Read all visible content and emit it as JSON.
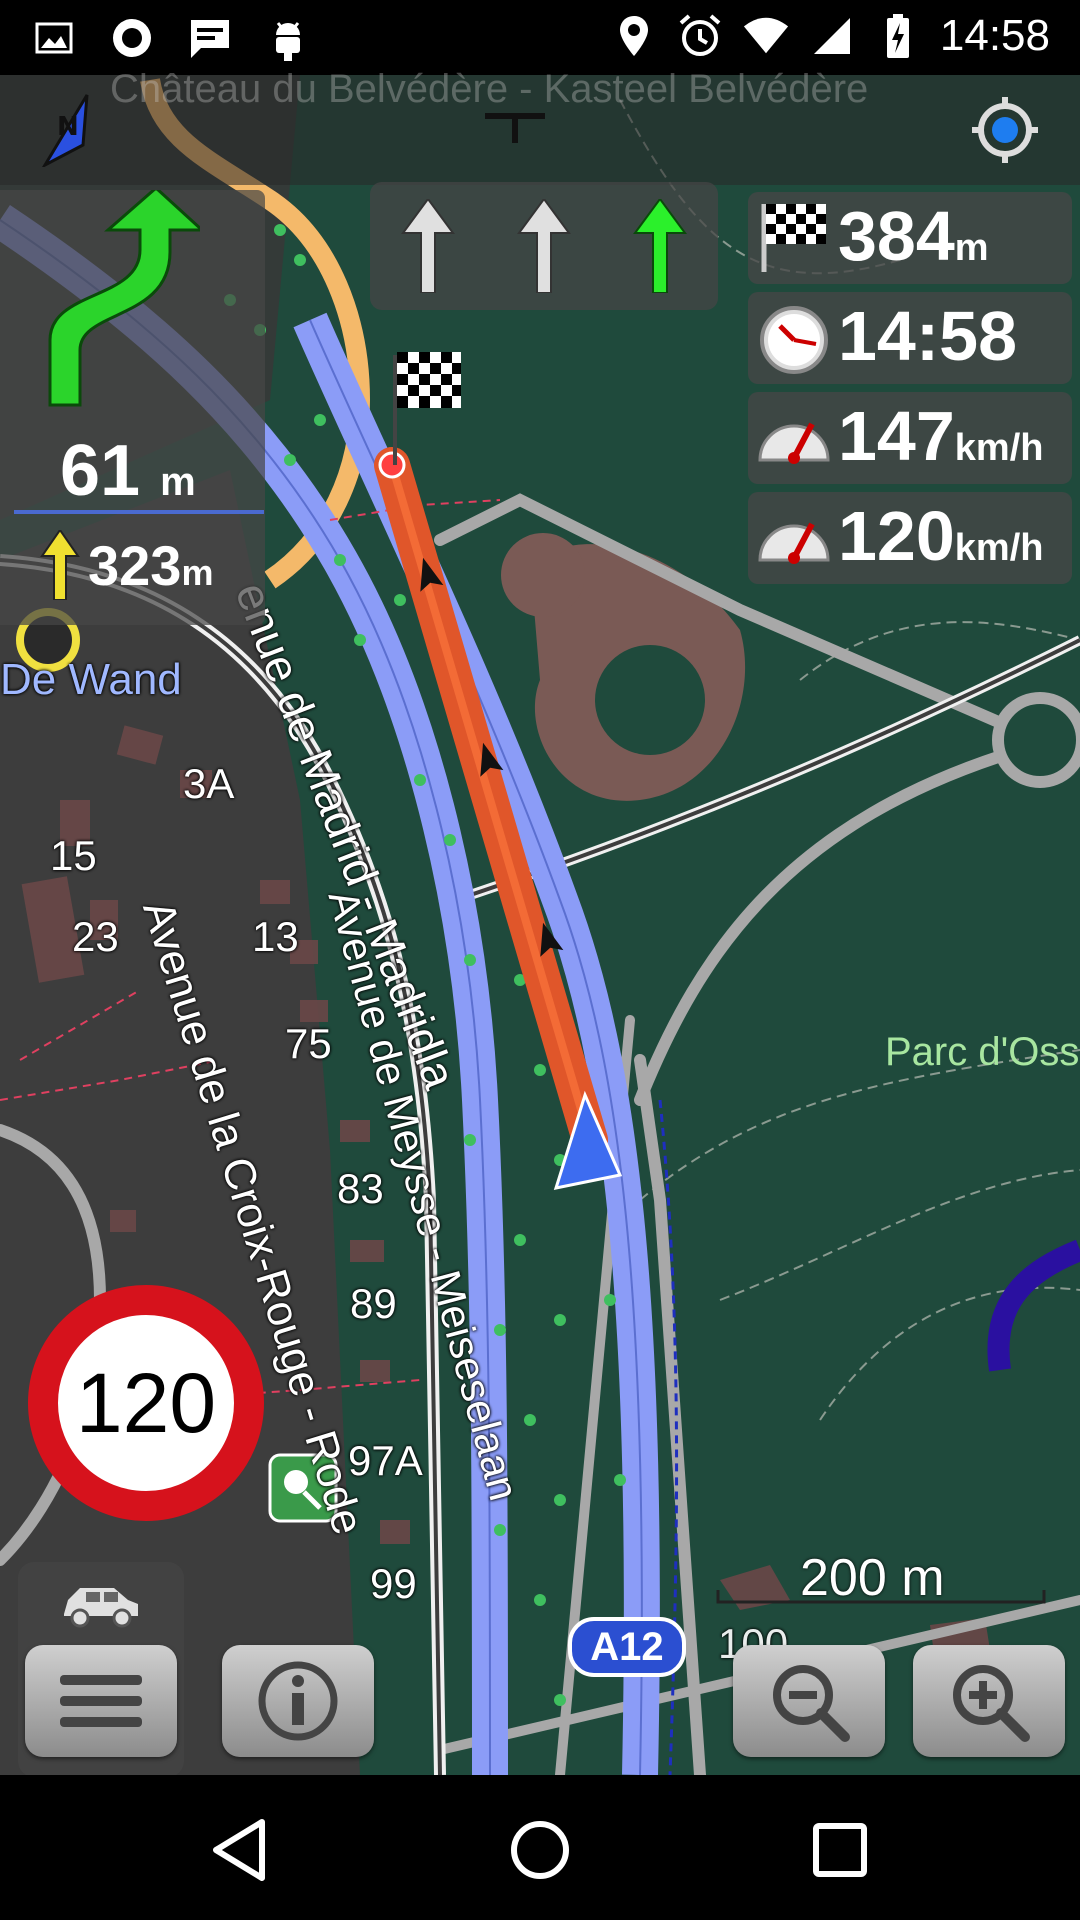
{
  "status_bar": {
    "time": "14:58",
    "left_icons": [
      "image-icon",
      "record-icon",
      "chat-icon",
      "android-debug-icon"
    ],
    "right_icons": [
      "location-icon",
      "alarm-icon",
      "wifi-icon",
      "signal-icon",
      "battery-charging-icon"
    ]
  },
  "map": {
    "top_ghost_label": "Château du Belvédère - Kasteel Belvédère",
    "labels": {
      "place": "De Wand",
      "street_madrid": "enue de Madrid - Madridla",
      "street_croix": "Avenue de la Croix-Rouge - Rode",
      "street_meysse": "Avenue de Meysse - Meiseselaan",
      "park": "Parc d'Oss",
      "route_badge": "A12"
    },
    "house_numbers": [
      "3A",
      "15",
      "23",
      "13",
      "75",
      "83",
      "89",
      "97A",
      "99",
      "100"
    ],
    "colors": {
      "park": "#1f4a3c",
      "motorway": "#8b9cf7",
      "route": "#e0562a",
      "road": "#b0b0b0",
      "urban": "#3d3d3d"
    }
  },
  "navigation": {
    "turn_distance": "61",
    "turn_unit": "m",
    "next_turn_distance": "323",
    "next_turn_unit": "m",
    "lanes": [
      {
        "direction": "straight",
        "active": false
      },
      {
        "direction": "straight",
        "active": false
      },
      {
        "direction": "straight",
        "active": true
      }
    ]
  },
  "widgets": {
    "distance_to_destination": {
      "value": "384",
      "unit": "m",
      "icon": "checkered-flag-icon"
    },
    "arrival_time": {
      "value": "14:58",
      "unit": "",
      "icon": "clock-icon"
    },
    "current_speed": {
      "value": "147",
      "unit": "km/h",
      "icon": "speedometer-icon"
    },
    "max_speed": {
      "value": "120",
      "unit": "km/h",
      "icon": "speedometer-icon"
    }
  },
  "speed_limit": "120",
  "scale": {
    "label": "200 m"
  },
  "buttons": {
    "menu": "menu-icon",
    "info": "info-icon",
    "zoom_out": "zoom-out-icon",
    "zoom_in": "zoom-in-icon"
  }
}
